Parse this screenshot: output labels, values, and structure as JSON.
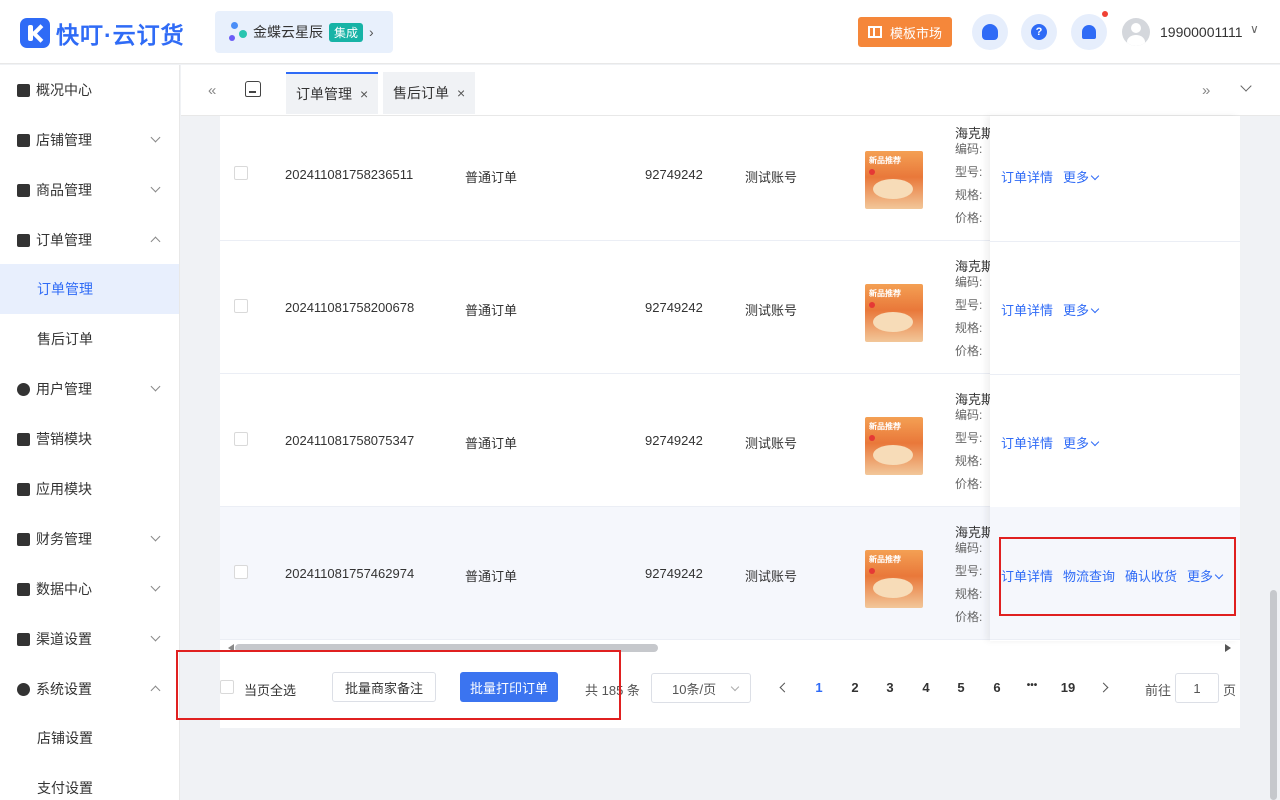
{
  "header": {
    "logo_text": "快叮·云订货",
    "kingdee_name": "金蝶云星辰",
    "kingdee_badge": "集成",
    "kingdee_arrow": "›",
    "market_label": "模板市场",
    "help_glyph": "?",
    "user_phone": "19900001111",
    "user_caret": "∨"
  },
  "sidebar": {
    "items": [
      {
        "label": "概况中心",
        "icon": "dashboard-icon"
      },
      {
        "label": "店铺管理",
        "icon": "store-icon"
      },
      {
        "label": "商品管理",
        "icon": "goods-icon"
      },
      {
        "label": "订单管理",
        "icon": "order-icon"
      },
      {
        "label": "订单管理",
        "icon": ""
      },
      {
        "label": "售后订单",
        "icon": ""
      },
      {
        "label": "用户管理",
        "icon": "user-icon"
      },
      {
        "label": "营销模块",
        "icon": "marketing-icon"
      },
      {
        "label": "应用模块",
        "icon": "apps-icon"
      },
      {
        "label": "财务管理",
        "icon": "wallet-icon"
      },
      {
        "label": "数据中心",
        "icon": "chart-icon"
      },
      {
        "label": "渠道设置",
        "icon": "channel-icon"
      },
      {
        "label": "系统设置",
        "icon": "gear-icon"
      },
      {
        "label": "店铺设置",
        "icon": ""
      },
      {
        "label": "支付设置",
        "icon": ""
      }
    ]
  },
  "tabs": {
    "items": [
      {
        "label": "订单管理",
        "close": "×"
      },
      {
        "label": "售后订单",
        "close": "×"
      }
    ],
    "collapse_glyph": "«",
    "expand_glyph": "»"
  },
  "orders": {
    "rows": [
      {
        "order_no": "202411081758236511",
        "type": "普通订单",
        "account_id": "92749242",
        "account_name": "测试账号"
      },
      {
        "order_no": "202411081758200678",
        "type": "普通订单",
        "account_id": "92749242",
        "account_name": "测试账号"
      },
      {
        "order_no": "202411081758075347",
        "type": "普通订单",
        "account_id": "92749242",
        "account_name": "测试账号"
      },
      {
        "order_no": "202411081757462974",
        "type": "普通订单",
        "account_id": "92749242",
        "account_name": "测试账号"
      }
    ],
    "product": {
      "title": "海克斯",
      "code_label": "编码:",
      "model_label": "型号:",
      "spec_label": "规格:",
      "price_label": "价格:",
      "thumb_tag": "新品推荐"
    },
    "actions": {
      "detail": "订单详情",
      "more": "更多",
      "logistics": "物流查询",
      "confirm": "确认收货"
    }
  },
  "footer": {
    "select_all": "当页全选",
    "batch_remark": "批量商家备注",
    "batch_print": "批量打印订单",
    "total": "共 185 条",
    "page_size": "10条/页",
    "pages": [
      "1",
      "2",
      "3",
      "4",
      "5",
      "6",
      "•••",
      "19"
    ],
    "current_page": "1",
    "goto_label": "前往",
    "goto_value": "1",
    "page_suffix": "页"
  }
}
